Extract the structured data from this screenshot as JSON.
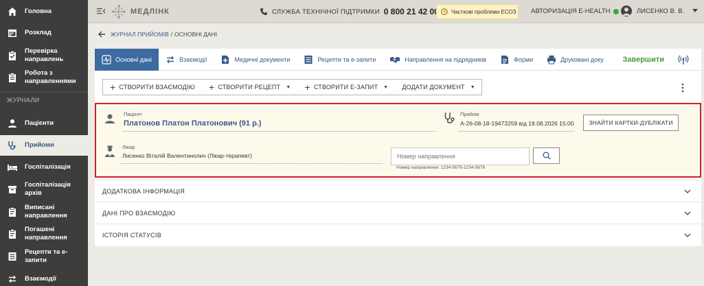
{
  "sidebar": {
    "items": [
      {
        "label": "Головна",
        "icon": "home-icon"
      },
      {
        "label": "Розклад",
        "icon": "calendar-icon"
      },
      {
        "label": "Перевірка направлень",
        "icon": "clipboard-check-icon"
      },
      {
        "label": "Робота з направленнями",
        "icon": "clipboard-icon"
      },
      {
        "label": "Пацієнти",
        "icon": "person-icon"
      },
      {
        "label": "Прийоми",
        "icon": "stethoscope-icon"
      },
      {
        "label": "Госпіталізація",
        "icon": "bed-icon"
      },
      {
        "label": "Госпіталізація архів",
        "icon": "archive-icon"
      },
      {
        "label": "Виписані направлення",
        "icon": "document-icon"
      },
      {
        "label": "Погашені направлення",
        "icon": "document-icon"
      },
      {
        "label": "Рецепти та е-запити",
        "icon": "list-icon"
      },
      {
        "label": "Взаємодії",
        "icon": "swap-icon"
      }
    ],
    "section_label": "ЖУРНАЛИ",
    "active_index": 5
  },
  "topbar": {
    "logo_text": "МЕДЛІНК",
    "support_label": "СЛУЖБА ТЕХНІЧНОЇ ПІДТРИМКИ",
    "support_phone": "0 800 21 42 00",
    "warning": "Часткові проблеми ЕСОЗ",
    "ehealth_label": "АВТОРИЗАЦІЯ E-HEALTH",
    "user_name": "ЛИСЕНКО В. В."
  },
  "breadcrumb": {
    "parent": "ЖУРНАЛ ПРИЙОМІВ",
    "separator": "/",
    "current": "ОСНОВНІ ДАНІ"
  },
  "tabs": [
    {
      "label": "Основні дані",
      "icon": "chart-icon"
    },
    {
      "label": "Взаємодії",
      "icon": "swap-icon"
    },
    {
      "label": "Медичні документи",
      "icon": "medical-doc-icon"
    },
    {
      "label": "Рецепти та е-запити",
      "icon": "list-icon"
    },
    {
      "label": "Направлення на підрядників",
      "icon": "handshake-icon"
    },
    {
      "label": "Форми",
      "icon": "form-icon"
    },
    {
      "label": "Друковані доку",
      "icon": "printer-icon"
    },
    {
      "label": "Завершити",
      "icon": ""
    }
  ],
  "toolbar": {
    "create_interaction": "СТВОРИТИ ВЗАЄМОДІЮ",
    "create_recipe": "СТВОРИТИ РЕЦЕПТ",
    "create_erequest": "СТВОРИТИ Е-ЗАПИТ",
    "add_document": "ДОДАТИ ДОКУМЕНТ"
  },
  "patient": {
    "label": "Пацієнт",
    "name": "Платонов Платон Платонович (91 р.)",
    "appointment_label": "Прийом",
    "appointment_value": "A-26-08-18-19473259 від 18.08.2026 15:00",
    "find_duplicates": "ЗНАЙТИ КАРТКИ-ДУБЛІКАТИ",
    "doctor_label": "Лікар",
    "doctor_value": "Лисенко Віталій Валентинолич (Лікар-терапевт)",
    "referral_placeholder": "Номер направлення",
    "referral_hint": "Номер направлення: 1234-5678-1234-5678"
  },
  "accordions": [
    {
      "label": "ДОДАТКОВА ІНФОРМАЦІЯ"
    },
    {
      "label": "ДАНІ ПРО ВЗАЄМОДІЮ"
    },
    {
      "label": "ІСТОРІЯ СТАТУСІВ"
    }
  ],
  "colors": {
    "sidebar_bg": "#3d3d3b",
    "accent": "#3a5a86",
    "active_tab": "#3d6aa0",
    "finish": "#4a9a3c",
    "highlight_border": "#d0202a",
    "status_ok": "#3aa64a"
  }
}
